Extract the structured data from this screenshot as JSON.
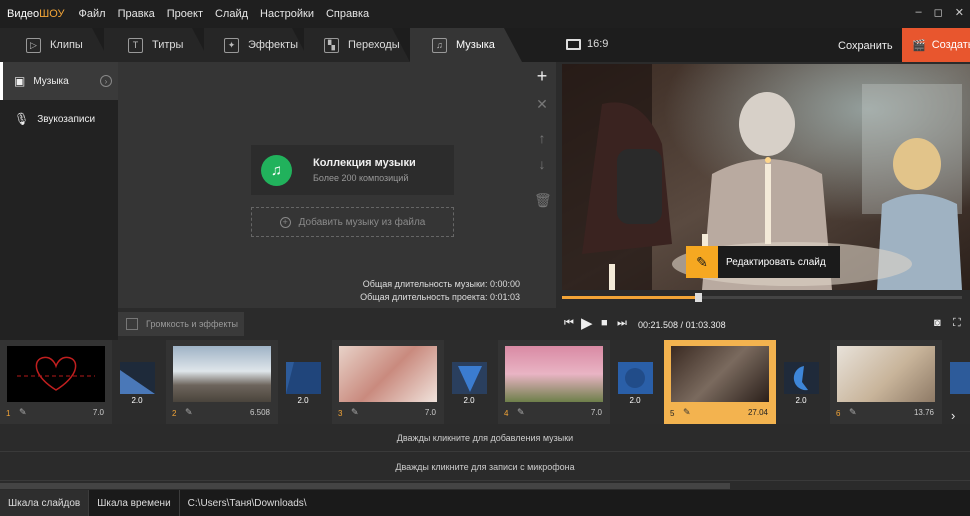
{
  "app": {
    "logo_part1": "Видео",
    "logo_part2": "ШОУ",
    "menu": [
      "Файл",
      "Правка",
      "Проект",
      "Слайд",
      "Настройки",
      "Справка"
    ],
    "window_controls": [
      "–",
      "◻",
      "✕"
    ]
  },
  "tabs": [
    {
      "label": "Клипы",
      "icon": "play-icon"
    },
    {
      "label": "Титры",
      "icon": "text-icon"
    },
    {
      "label": "Эффекты",
      "icon": "magic-wand-icon"
    },
    {
      "label": "Переходы",
      "icon": "transition-icon"
    },
    {
      "label": "Музыка",
      "icon": "music-note-icon"
    }
  ],
  "active_tab": "Музыка",
  "header": {
    "aspect_ratio": "16:9",
    "save_label": "Сохранить",
    "create_label": "Создать"
  },
  "sidebar": {
    "items": [
      {
        "label": "Музыка",
        "icon": "music-note-icon",
        "active": true
      },
      {
        "label": "Звукозаписи",
        "icon": "microphone-icon",
        "active": false
      }
    ]
  },
  "music_panel": {
    "collection_title": "Коллекция музыки",
    "collection_subtitle": "Более 200 композиций",
    "add_file_label": "Добавить музыку из файла",
    "music_duration": "Общая длительность музыки: 0:00:00",
    "project_duration": "Общая длительность проекта: 0:01:03"
  },
  "volume_button": "Громкость и эффекты",
  "preview": {
    "edit_slide_label": "Редактировать слайд",
    "current_time": "00:21.508",
    "total_time": "01:03.308",
    "progress": 0.34
  },
  "timeline": {
    "slides": [
      {
        "num": "1",
        "duration": "7.0",
        "selected": false
      },
      {
        "num": "2",
        "duration": "6.508",
        "selected": false
      },
      {
        "num": "3",
        "duration": "7.0",
        "selected": false
      },
      {
        "num": "4",
        "duration": "7.0",
        "selected": false
      },
      {
        "num": "5",
        "duration": "27.04",
        "selected": true
      },
      {
        "num": "6",
        "duration": "13.76",
        "selected": false
      }
    ],
    "transitions": [
      {
        "duration": "2.0"
      },
      {
        "duration": "2.0"
      },
      {
        "duration": "2.0"
      },
      {
        "duration": "2.0"
      },
      {
        "duration": "2.0"
      }
    ],
    "music_hint": "Дважды кликните для добавления музыки",
    "mic_hint": "Дважды кликните для записи с микрофона"
  },
  "statusbar": {
    "slides_scale": "Шкала слайдов",
    "timeline_scale": "Шкала времени",
    "path": "C:\\Users\\Таня\\Downloads\\"
  },
  "colors": {
    "accent": "#f2a437",
    "create_button": "#e8562e",
    "music_collection_icon": "#21b25c"
  }
}
